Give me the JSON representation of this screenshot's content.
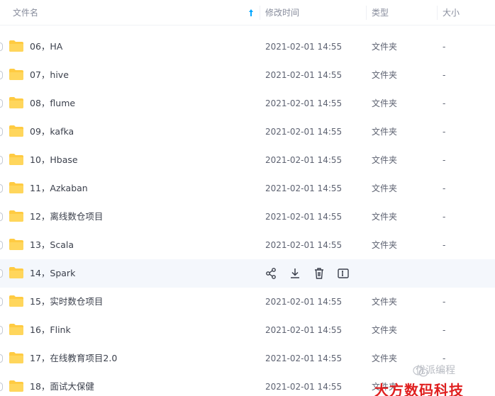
{
  "header": {
    "col_name": "文件名",
    "col_modified": "修改时间",
    "col_type": "类型",
    "col_size": "大小"
  },
  "files": [
    {
      "name": "06，HA",
      "modified": "2021-02-01 14:55",
      "type": "文件夹",
      "size": "-"
    },
    {
      "name": "07，hive",
      "modified": "2021-02-01 14:55",
      "type": "文件夹",
      "size": "-"
    },
    {
      "name": "08，flume",
      "modified": "2021-02-01 14:55",
      "type": "文件夹",
      "size": "-"
    },
    {
      "name": "09，kafka",
      "modified": "2021-02-01 14:55",
      "type": "文件夹",
      "size": "-"
    },
    {
      "name": "10，Hbase",
      "modified": "2021-02-01 14:55",
      "type": "文件夹",
      "size": "-"
    },
    {
      "name": "11，Azkaban",
      "modified": "2021-02-01 14:55",
      "type": "文件夹",
      "size": "-"
    },
    {
      "name": "12，离线数仓项目",
      "modified": "2021-02-01 14:55",
      "type": "文件夹",
      "size": "-"
    },
    {
      "name": "13，Scala",
      "modified": "2021-02-01 14:55",
      "type": "文件夹",
      "size": "-"
    },
    {
      "name": "14，Spark",
      "hovered": true
    },
    {
      "name": "15，实时数仓项目",
      "modified": "2021-02-01 14:55",
      "type": "文件夹",
      "size": "-"
    },
    {
      "name": "16，Flink",
      "modified": "2021-02-01 14:55",
      "type": "文件夹",
      "size": "-"
    },
    {
      "name": "17，在线教育项目2.0",
      "modified": "2021-02-01 14:55",
      "type": "文件夹",
      "size": "-"
    },
    {
      "name": "18，面试大保健",
      "modified": "2021-02-01 14:55",
      "type": "文件夹",
      "size": "-"
    }
  ],
  "row_actions": [
    "share-icon",
    "download-icon",
    "delete-icon",
    "rename-icon"
  ],
  "colors": {
    "folder": "#ffcb42",
    "sort_arrow": "#06a7ff",
    "hover_row": "#f4f7fc",
    "watermark_red": "#e02020"
  },
  "watermark": {
    "line1": "优派编程",
    "line2": "大方数码科技"
  }
}
